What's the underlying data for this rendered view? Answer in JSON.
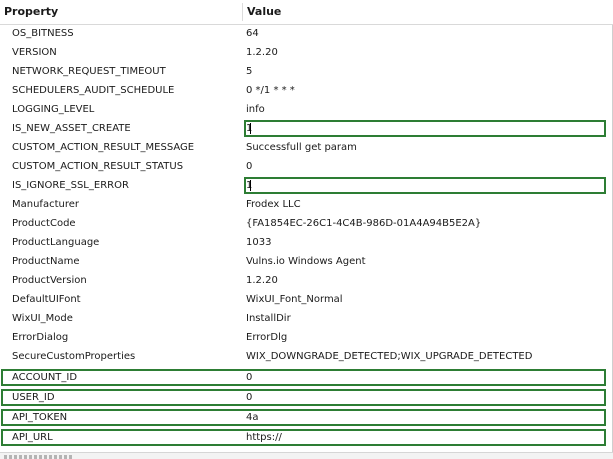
{
  "table": {
    "headers": {
      "property": "Property",
      "value": "Value"
    },
    "rows": [
      {
        "name": "OS_BITNESS",
        "value": "64"
      },
      {
        "name": "VERSION",
        "value": "1.2.20"
      },
      {
        "name": "NETWORK_REQUEST_TIMEOUT",
        "value": "5"
      },
      {
        "name": "SCHEDULERS_AUDIT_SCHEDULE",
        "value": "0 */1 * * *"
      },
      {
        "name": "LOGGING_LEVEL",
        "value": "info"
      },
      {
        "name": "IS_NEW_ASSET_CREATE",
        "value": "1"
      },
      {
        "name": "CUSTOM_ACTION_RESULT_MESSAGE",
        "value": "Successfull get param"
      },
      {
        "name": "CUSTOM_ACTION_RESULT_STATUS",
        "value": "0"
      },
      {
        "name": "IS_IGNORE_SSL_ERROR",
        "value": "1"
      },
      {
        "name": "Manufacturer",
        "value": "Frodex LLC"
      },
      {
        "name": "ProductCode",
        "value": "{FA1854EC-26C1-4C4B-986D-01A4A94B5E2A}"
      },
      {
        "name": "ProductLanguage",
        "value": "1033"
      },
      {
        "name": "ProductName",
        "value": "Vulns.io Windows Agent"
      },
      {
        "name": "ProductVersion",
        "value": "1.2.20"
      },
      {
        "name": "DefaultUIFont",
        "value": "WixUI_Font_Normal"
      },
      {
        "name": "WixUI_Mode",
        "value": "InstallDir"
      },
      {
        "name": "ErrorDialog",
        "value": "ErrorDlg"
      },
      {
        "name": "SecureCustomProperties",
        "value": "WIX_DOWNGRADE_DETECTED;WIX_UPGRADE_DETECTED"
      },
      {
        "name": "ACCOUNT_ID",
        "value": "0"
      },
      {
        "name": "USER_ID",
        "value": "0"
      },
      {
        "name": "API_TOKEN",
        "value": "4a"
      },
      {
        "name": "API_URL",
        "value": "https://"
      }
    ]
  },
  "colors": {
    "highlight_border": "#2d7d34"
  }
}
